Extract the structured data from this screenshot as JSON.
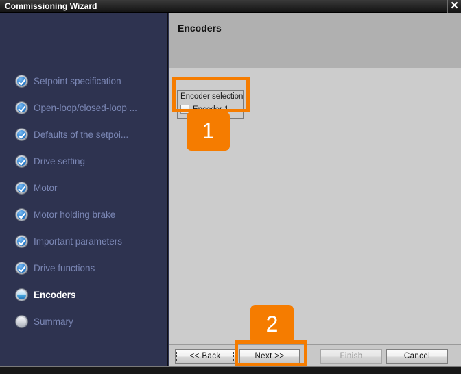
{
  "window": {
    "title": "Commissioning Wizard",
    "close_label": "✕"
  },
  "sidebar": {
    "items": [
      {
        "label": "Setpoint specification",
        "state": "done"
      },
      {
        "label": "Open-loop/closed-loop ...",
        "state": "done"
      },
      {
        "label": "Defaults of the setpoi...",
        "state": "done"
      },
      {
        "label": "Drive setting",
        "state": "done"
      },
      {
        "label": "Motor",
        "state": "done"
      },
      {
        "label": "Motor holding brake",
        "state": "done"
      },
      {
        "label": "Important parameters",
        "state": "done"
      },
      {
        "label": "Drive functions",
        "state": "done"
      },
      {
        "label": "Encoders",
        "state": "active"
      },
      {
        "label": "Summary",
        "state": "pending"
      }
    ]
  },
  "panel": {
    "title": "Encoders",
    "encoder_selection": {
      "group_title": "Encoder selection",
      "checkbox_label": "Encoder 1",
      "checked": false
    }
  },
  "buttons": {
    "back": "<< Back",
    "next": "Next >>",
    "finish": "Finish",
    "cancel": "Cancel"
  },
  "annotations": {
    "badge_1": "1",
    "badge_2": "2",
    "color": "#f57c00"
  }
}
